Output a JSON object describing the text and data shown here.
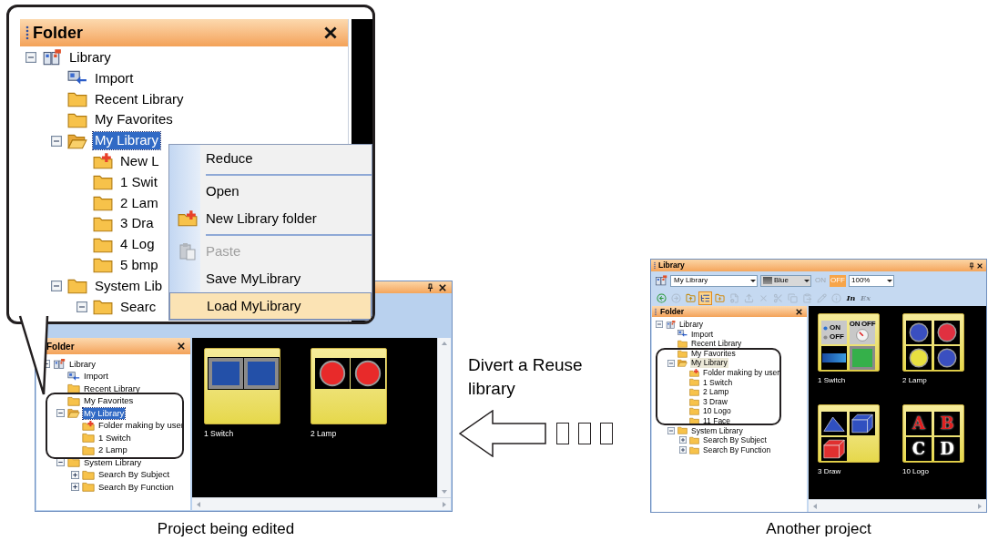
{
  "callout": {
    "panel": {
      "title": "Folder"
    },
    "tree_focused": true,
    "tree": [
      {
        "label": "Library",
        "kind": "library",
        "expanded": true,
        "selected": false,
        "children": [
          {
            "label": "Import",
            "kind": "import",
            "selected": false
          },
          {
            "label": "Recent Library",
            "kind": "folder",
            "selected": false
          },
          {
            "label": "My Favorites",
            "kind": "folder",
            "selected": false
          },
          {
            "label": "My Library",
            "kind": "folder-open",
            "expanded": true,
            "selected": true,
            "children": [
              {
                "label": "New L",
                "kind": "new-folder",
                "selected": false
              },
              {
                "label": "1 Swit",
                "kind": "folder",
                "selected": false
              },
              {
                "label": "2 Lam",
                "kind": "folder",
                "selected": false
              },
              {
                "label": "3 Dra",
                "kind": "folder",
                "selected": false
              },
              {
                "label": "4 Log",
                "kind": "folder",
                "selected": false
              },
              {
                "label": "5 bmp",
                "kind": "folder",
                "selected": false
              }
            ]
          },
          {
            "label": "System Lib",
            "kind": "folder",
            "expanded": true,
            "selected": false,
            "children": [
              {
                "label": "Searc",
                "kind": "folder",
                "expanded": true,
                "selected": false
              }
            ]
          }
        ]
      }
    ],
    "context_menu": [
      {
        "kind": "plain",
        "label": "Reduce",
        "disabled": false,
        "selected": false
      },
      {
        "kind": "separator"
      },
      {
        "kind": "plain",
        "label": "Open",
        "disabled": false,
        "selected": false
      },
      {
        "kind": "new-folder",
        "label": "New Library folder",
        "disabled": false,
        "selected": false
      },
      {
        "kind": "separator"
      },
      {
        "kind": "paste",
        "label": "Paste",
        "disabled": true,
        "selected": false
      },
      {
        "kind": "plain",
        "label": "Save MyLibrary",
        "disabled": false,
        "selected": false
      },
      {
        "kind": "plain",
        "label": "Load MyLibrary",
        "disabled": false,
        "selected": true
      }
    ]
  },
  "left_window": {
    "panel": {
      "title": "Folder"
    },
    "tree_focused": true,
    "tree": [
      {
        "label": "Library",
        "kind": "library",
        "expanded": true,
        "selected": false,
        "children": [
          {
            "label": "Import",
            "kind": "import",
            "selected": false
          },
          {
            "label": "Recent Library",
            "kind": "folder",
            "selected": false
          },
          {
            "label": "My Favorites",
            "kind": "folder",
            "selected": false
          },
          {
            "label": "My Library",
            "kind": "folder-open",
            "expanded": true,
            "selected": true,
            "children": [
              {
                "label": "Folder making by user",
                "kind": "new-folder",
                "selected": false
              },
              {
                "label": "1 Switch",
                "kind": "folder",
                "selected": false
              },
              {
                "label": "2 Lamp",
                "kind": "folder",
                "selected": false
              }
            ]
          },
          {
            "label": "System Library",
            "kind": "folder",
            "expanded": true,
            "selected": false,
            "children": [
              {
                "label": "Search By Subject",
                "kind": "folder",
                "expanded": false,
                "selected": false
              },
              {
                "label": "Search By Function",
                "kind": "folder",
                "expanded": false,
                "selected": false
              }
            ]
          }
        ]
      }
    ],
    "thumbnails": [
      {
        "label": "1 Switch",
        "tiles": [
          {
            "kind": "blue-square"
          },
          {
            "kind": "blue-square"
          }
        ]
      },
      {
        "label": "2 Lamp",
        "tiles": [
          {
            "kind": "lamp",
            "color": "#e82a2a"
          },
          {
            "kind": "lamp",
            "color": "#e82a2a"
          }
        ]
      }
    ]
  },
  "middle": {
    "text": "Divert a Reuse library"
  },
  "right_window": {
    "title": "Library",
    "library_select": "My Library",
    "color_select": "Blue",
    "toggles": [
      {
        "label": "ON",
        "selected": false
      },
      {
        "label": "OFF",
        "selected": true
      }
    ],
    "zoom_select": "100%",
    "toolbar": [
      {
        "kind": "back",
        "disabled": false,
        "pressed": false
      },
      {
        "kind": "forward",
        "disabled": true,
        "pressed": false
      },
      {
        "kind": "folder-up",
        "disabled": false,
        "pressed": false
      },
      {
        "kind": "tree-view",
        "disabled": false,
        "pressed": true
      },
      {
        "kind": "new-folder",
        "disabled": false,
        "pressed": false
      },
      {
        "kind": "properties",
        "disabled": true,
        "pressed": false
      },
      {
        "kind": "export",
        "disabled": true,
        "pressed": false
      },
      {
        "kind": "delete",
        "disabled": true,
        "pressed": false
      },
      {
        "kind": "cut",
        "disabled": true,
        "pressed": false
      },
      {
        "kind": "copy",
        "disabled": true,
        "pressed": false
      },
      {
        "kind": "paste",
        "disabled": true,
        "pressed": false
      },
      {
        "kind": "edit",
        "disabled": true,
        "pressed": false
      },
      {
        "kind": "info",
        "disabled": true,
        "pressed": false
      },
      {
        "kind": "text",
        "text": "In",
        "disabled": false,
        "pressed": false
      },
      {
        "kind": "text",
        "text": "Ex",
        "disabled": true,
        "pressed": false
      }
    ],
    "panel": {
      "title": "Folder"
    },
    "tree_focused": false,
    "tree": [
      {
        "label": "Library",
        "kind": "library",
        "expanded": true,
        "selected": false,
        "children": [
          {
            "label": "Import",
            "kind": "import",
            "selected": false
          },
          {
            "label": "Recent Library",
            "kind": "folder",
            "selected": false
          },
          {
            "label": "My Favorites",
            "kind": "folder",
            "selected": false
          },
          {
            "label": "My Library",
            "kind": "folder-open",
            "expanded": true,
            "selected": true,
            "children": [
              {
                "label": "Folder making by user",
                "kind": "new-folder",
                "selected": false
              },
              {
                "label": "1 Switch",
                "kind": "folder",
                "selected": false
              },
              {
                "label": "2 Lamp",
                "kind": "folder",
                "selected": false
              },
              {
                "label": "3 Draw",
                "kind": "folder",
                "selected": false
              },
              {
                "label": "10 Logo",
                "kind": "folder",
                "selected": false
              },
              {
                "label": "11 Face",
                "kind": "folder",
                "selected": false
              }
            ]
          },
          {
            "label": "System Library",
            "kind": "folder",
            "expanded": true,
            "selected": false,
            "children": [
              {
                "label": "Search By Subject",
                "kind": "folder",
                "expanded": false,
                "selected": false
              },
              {
                "label": "Search By Function",
                "kind": "folder",
                "expanded": false,
                "selected": false
              }
            ]
          }
        ]
      }
    ],
    "thumbnails": [
      {
        "label": "1 Switch",
        "tiles": [
          {
            "kind": "radio-switch",
            "texts": [
              "ON",
              "OFF"
            ]
          },
          {
            "kind": "rotary-switch",
            "text": "ON OFF"
          },
          {
            "kind": "blue-bar"
          },
          {
            "kind": "green-square"
          }
        ]
      },
      {
        "label": "2 Lamp",
        "tiles": [
          {
            "kind": "lamp",
            "color": "#3a4fc0"
          },
          {
            "kind": "lamp",
            "color": "#e03040"
          },
          {
            "kind": "lamp",
            "color": "#e8e040"
          },
          {
            "kind": "lamp",
            "color": "#3a4fc0"
          }
        ]
      },
      {
        "label": "3 Draw",
        "tiles": [
          {
            "kind": "pyramid",
            "color": "#3050c0"
          },
          {
            "kind": "brick-box",
            "color": "#3050c0"
          },
          {
            "kind": "brick-box",
            "color": "#e03030"
          }
        ]
      },
      {
        "label": "10 Logo",
        "tiles": [
          {
            "kind": "letter",
            "text": "A",
            "color": "#e02020"
          },
          {
            "kind": "letter",
            "text": "B",
            "color": "#e02020"
          },
          {
            "kind": "letter",
            "text": "C",
            "color": "#ffffff"
          },
          {
            "kind": "letter",
            "text": "D",
            "color": "#ffffff"
          }
        ]
      }
    ]
  },
  "captions": [
    "Project being edited",
    "Another project"
  ]
}
